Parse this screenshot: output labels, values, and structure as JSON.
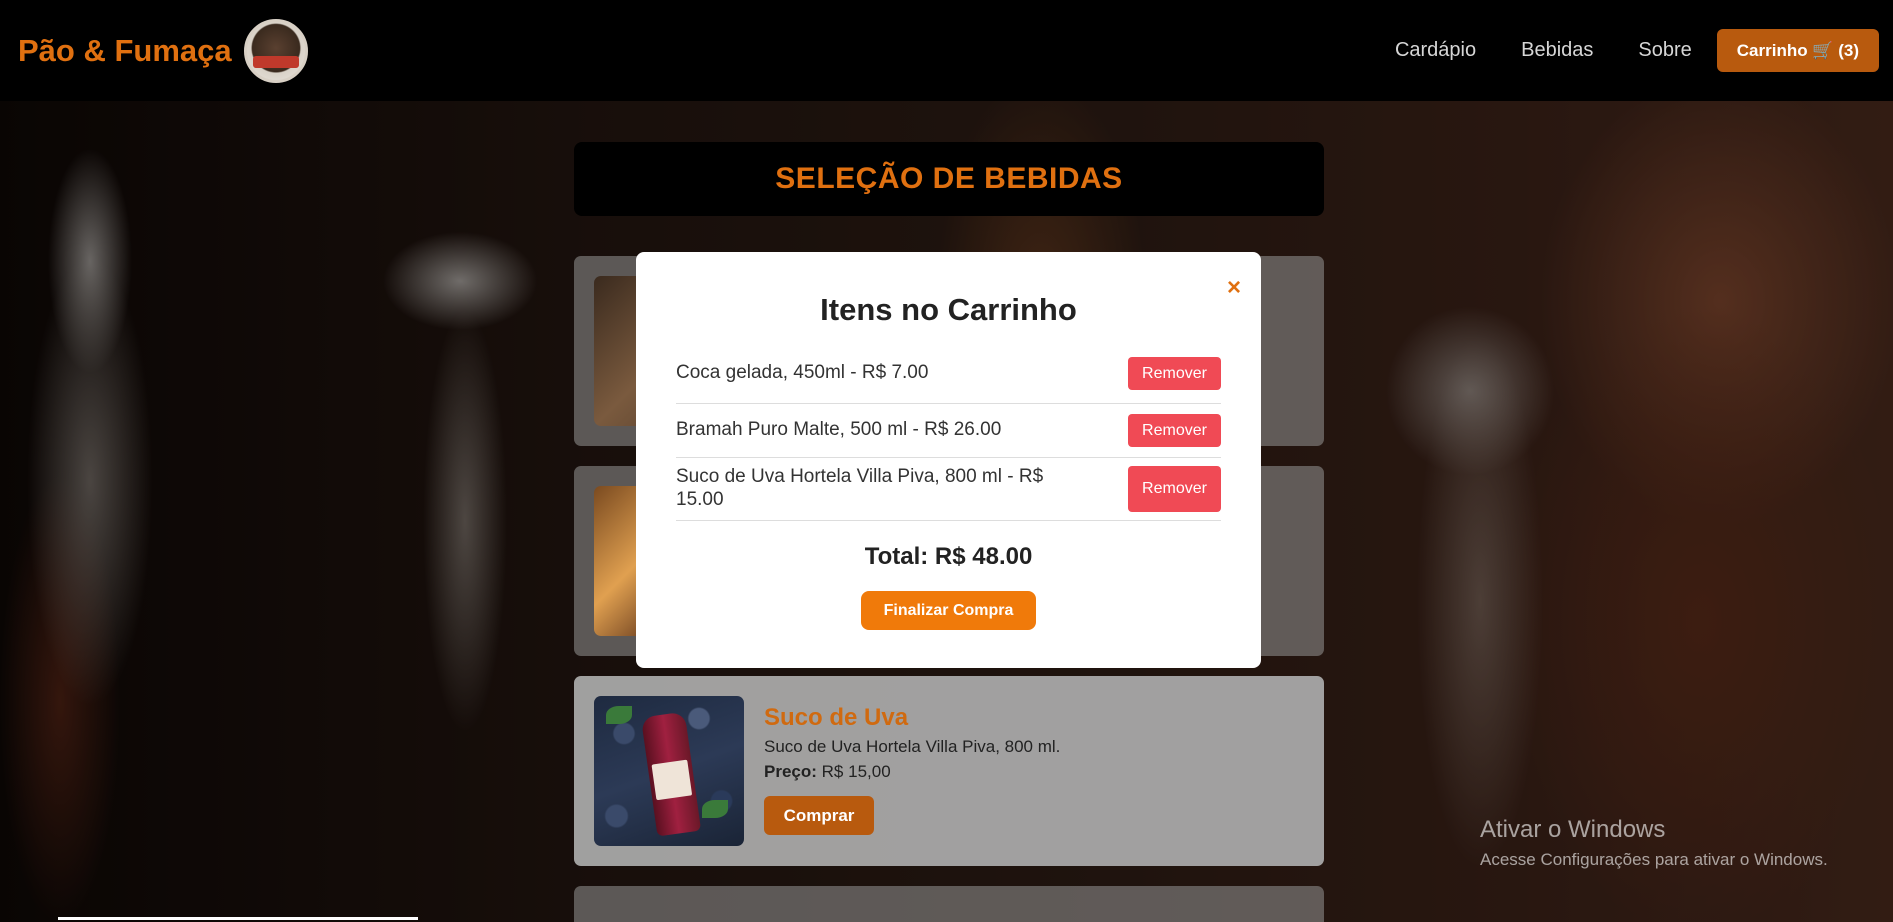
{
  "header": {
    "brand": "Pão & Fumaça",
    "nav": [
      {
        "label": "Cardápio"
      },
      {
        "label": "Bebidas"
      },
      {
        "label": "Sobre"
      }
    ],
    "cart_button": "Carrinho 🛒 (3)"
  },
  "main": {
    "section_title": "SELEÇÃO DE BEBIDAS",
    "products": [
      {
        "name": "Suco de Uva",
        "desc": "Suco de Uva Hortela Villa Piva, 800 ml.",
        "price_label": "Preço:",
        "price": "R$ 15,00",
        "buy_label": "Comprar"
      }
    ]
  },
  "modal": {
    "title": "Itens no Carrinho",
    "close": "×",
    "items": [
      {
        "text": "Coca gelada, 450ml - R$ 7.00",
        "remove": "Remover"
      },
      {
        "text": "Bramah Puro Malte, 500 ml - R$ 26.00",
        "remove": "Remover"
      },
      {
        "text": "Suco de Uva Hortela Villa Piva, 800 ml - R$ 15.00",
        "remove": "Remover"
      }
    ],
    "total": "Total: R$ 48.00",
    "checkout": "Finalizar Compra"
  },
  "watermark": {
    "title": "Ativar o Windows",
    "subtitle": "Acesse Configurações para ativar o Windows."
  },
  "colors": {
    "accent": "#e07010",
    "button": "#b85a0e",
    "remove": "#f04a55",
    "checkout": "#f07a0a"
  }
}
